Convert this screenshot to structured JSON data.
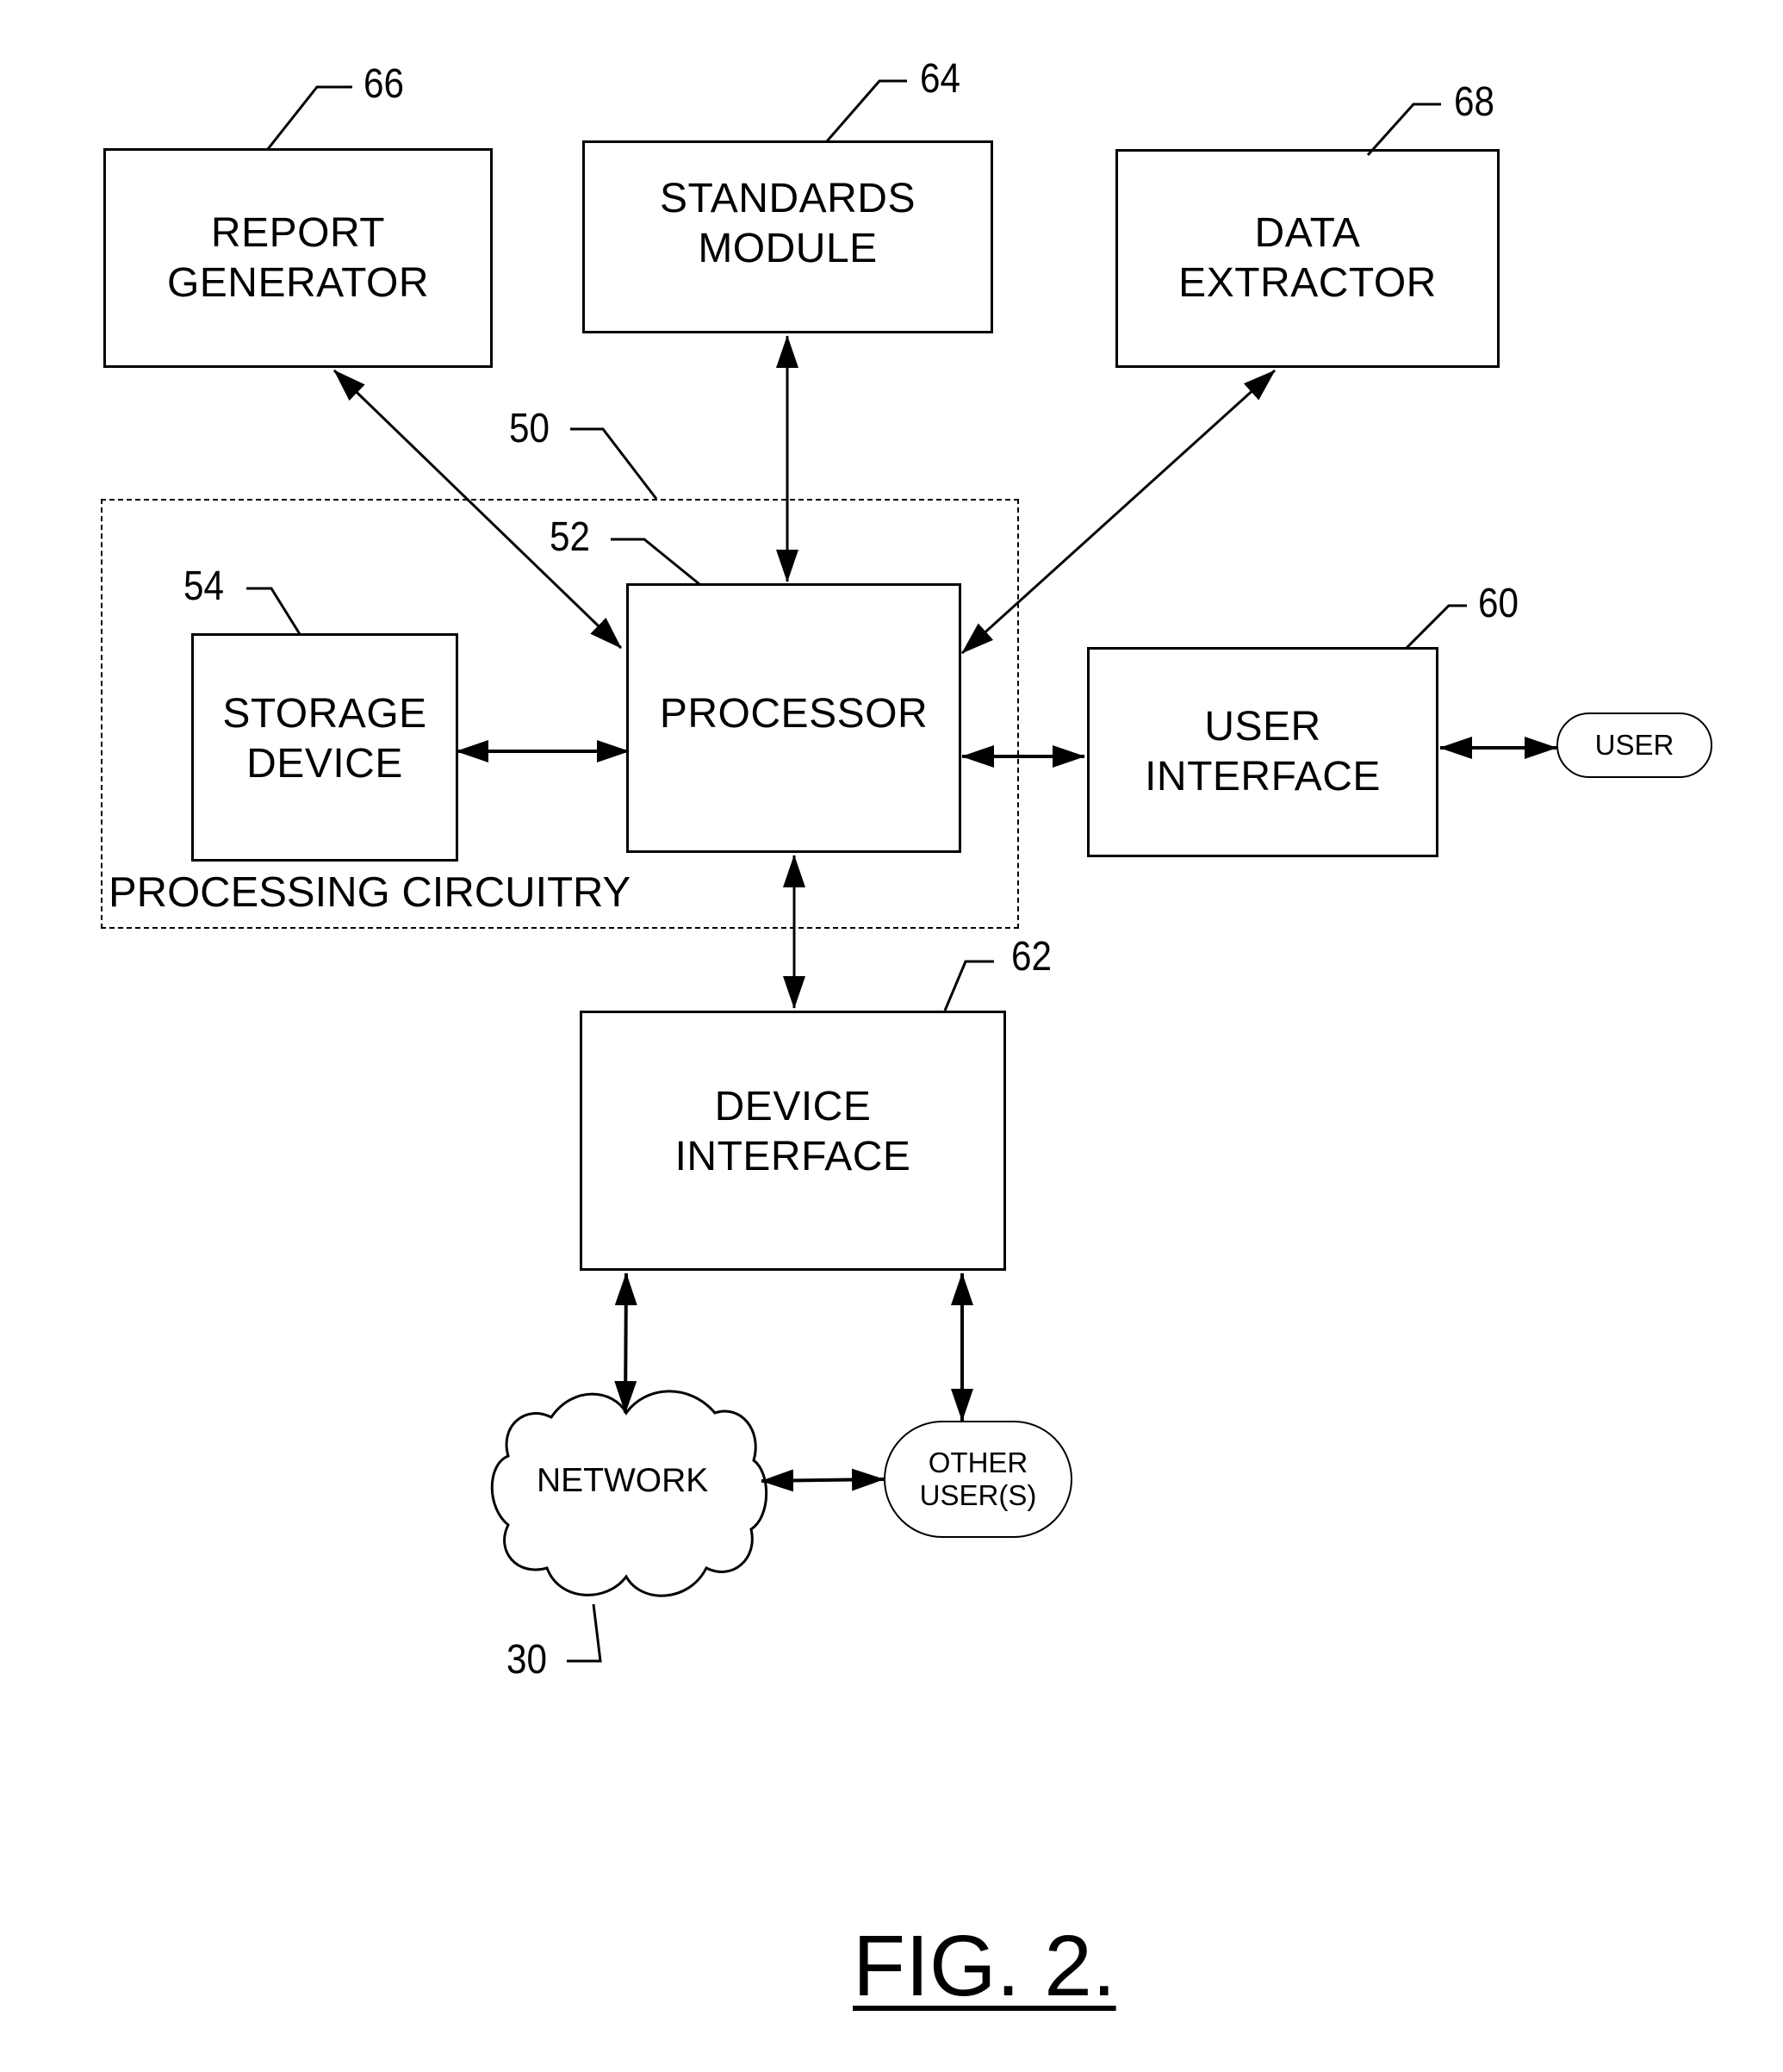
{
  "figure": {
    "caption": "FIG. 2.",
    "boxes": {
      "report_generator": {
        "label": "REPORT\nGENERATOR",
        "ref": "66"
      },
      "standards_module": {
        "label": "STANDARDS\nMODULE",
        "ref": "64"
      },
      "data_extractor": {
        "label": "DATA\nEXTRACTOR",
        "ref": "68"
      },
      "processor": {
        "label": "PROCESSOR",
        "ref": "52"
      },
      "storage_device": {
        "label": "STORAGE\nDEVICE",
        "ref": "54"
      },
      "user_interface": {
        "label": "USER\nINTERFACE",
        "ref": "60"
      },
      "device_interface": {
        "label": "DEVICE\nINTERFACE",
        "ref": "62"
      }
    },
    "processing_circuitry": {
      "label": "PROCESSING CIRCUITRY",
      "ref": "50"
    },
    "user": {
      "label": "USER"
    },
    "other_users": {
      "label": "OTHER\nUSER(S)"
    },
    "network": {
      "label": "NETWORK",
      "ref": "30"
    },
    "connections": [
      {
        "from": "report_generator",
        "to": "processor",
        "type": "bidirectional"
      },
      {
        "from": "standards_module",
        "to": "processor",
        "type": "bidirectional"
      },
      {
        "from": "data_extractor",
        "to": "processor",
        "type": "bidirectional"
      },
      {
        "from": "storage_device",
        "to": "processor",
        "type": "bidirectional"
      },
      {
        "from": "processor",
        "to": "user_interface",
        "type": "bidirectional"
      },
      {
        "from": "user_interface",
        "to": "user",
        "type": "bidirectional"
      },
      {
        "from": "processor",
        "to": "device_interface",
        "type": "bidirectional"
      },
      {
        "from": "device_interface",
        "to": "network",
        "type": "bidirectional"
      },
      {
        "from": "device_interface",
        "to": "other_users",
        "type": "bidirectional"
      },
      {
        "from": "network",
        "to": "other_users",
        "type": "bidirectional"
      }
    ]
  }
}
